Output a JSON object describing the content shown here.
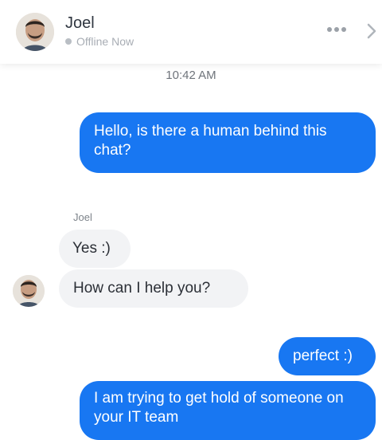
{
  "header": {
    "contact_name": "Joel",
    "status_text": "Offline Now",
    "status_dot_color": "#b9bec4",
    "avatar_icon": "avatar-joel",
    "more_icon": "more-horizontal-icon",
    "chevron_icon": "chevron-right-icon"
  },
  "conversation": {
    "timestamp": "10:42 AM",
    "sender_label": "Joel",
    "messages": [
      {
        "direction": "outgoing",
        "text": "Hello, is there a human behind this chat?"
      },
      {
        "direction": "incoming",
        "text": "Yes :)"
      },
      {
        "direction": "incoming",
        "text": "How can I help you?"
      },
      {
        "direction": "outgoing",
        "text": "perfect :)"
      },
      {
        "direction": "outgoing",
        "text": "I am trying to get hold of someone on your IT team"
      }
    ]
  },
  "colors": {
    "outgoing_bubble": "#1877f2",
    "incoming_bubble": "#f2f3f5",
    "timestamp_text": "#6f747b",
    "status_text": "#a8adb4"
  }
}
